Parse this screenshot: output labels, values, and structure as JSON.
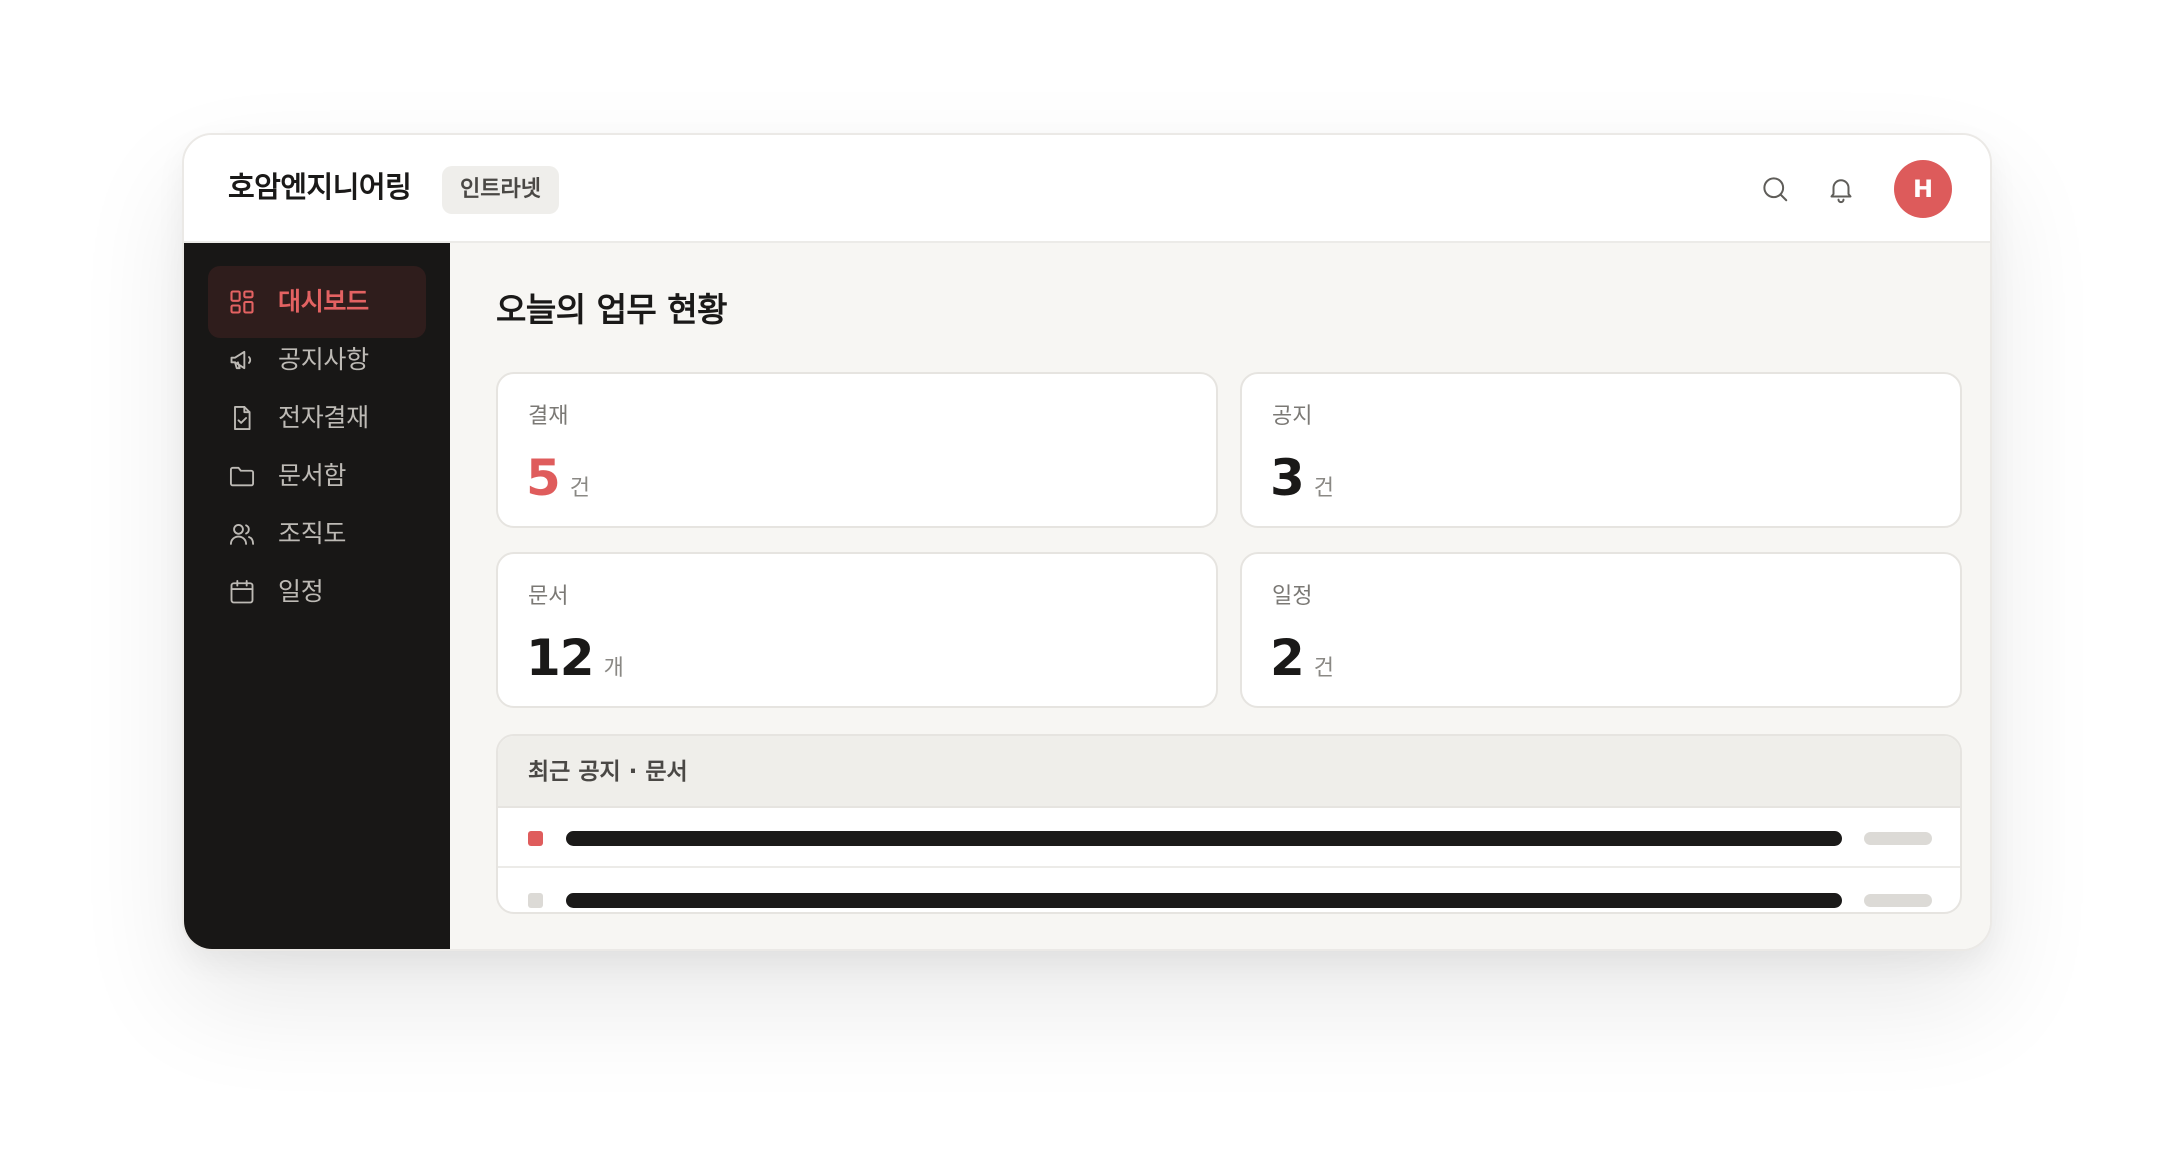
{
  "app": {
    "brand": "호암엔지니어링",
    "badge": "인트라넷",
    "avatar_initial": "H",
    "accent_color": "#df5c5c"
  },
  "header": {
    "icons": [
      "search-icon",
      "bell-icon"
    ]
  },
  "sidebar": {
    "items": [
      {
        "label": "대시보드",
        "icon": "dashboard-grid-icon",
        "active": true
      },
      {
        "label": "공지사항",
        "icon": "megaphone-icon",
        "active": false
      },
      {
        "label": "전자결재",
        "icon": "document-check-icon",
        "active": false
      },
      {
        "label": "문서함",
        "icon": "folder-icon",
        "active": false
      },
      {
        "label": "조직도",
        "icon": "users-icon",
        "active": false
      },
      {
        "label": "일정",
        "icon": "calendar-icon",
        "active": false
      }
    ]
  },
  "main": {
    "title": "오늘의 업무 현황",
    "stats": [
      {
        "label": "결재",
        "value": "5",
        "unit": "건"
      },
      {
        "label": "공지",
        "value": "3",
        "unit": "건"
      },
      {
        "label": "문서",
        "value": "12",
        "unit": "개"
      },
      {
        "label": "일정",
        "value": "2",
        "unit": "건"
      }
    ],
    "recent": {
      "title": "최근 공지 · 문서",
      "rows": [
        {
          "marker_color": "#df5c5c"
        },
        {
          "marker_color": "#dcdad6"
        }
      ]
    }
  }
}
